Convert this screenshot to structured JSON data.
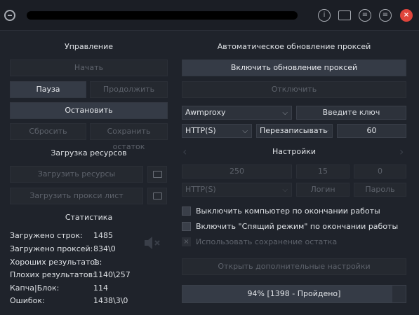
{
  "control": {
    "title": "Управление",
    "start": "Начать",
    "pause": "Пауза",
    "resume": "Продолжить",
    "stop": "Остановить",
    "reset": "Сбросить",
    "save_remainder": "Сохранить остаток"
  },
  "resources": {
    "title": "Загрузка ресурсов",
    "load_resources": "Загрузить ресурсы",
    "load_proxy_list": "Загрузить прокси лист"
  },
  "stats": {
    "title": "Статистика",
    "rows": [
      {
        "label": "Загружено строк:",
        "value": "1485"
      },
      {
        "label": "Загружено проксей:",
        "value": "834\\0"
      },
      {
        "label": "Хороших результатов:",
        "value": "1"
      },
      {
        "label": "Плохих результатов:",
        "value": "1140\\257"
      },
      {
        "label": "Капча|Блок:",
        "value": "114"
      },
      {
        "label": "Ошибок:",
        "value": "1438\\3\\0"
      }
    ]
  },
  "proxy_update": {
    "title": "Автоматическое обновление проксей",
    "enable": "Включить обновление проксей",
    "disable": "Отключить",
    "provider": "Awmproxy",
    "key_placeholder": "Введите ключ",
    "protocol": "HTTP(S)",
    "mode": "Перезаписывать",
    "interval": "60"
  },
  "settings": {
    "title": "Настройки",
    "threads": "250",
    "timeout": "15",
    "retries": "0",
    "protocol": "HTTP(S)",
    "login_placeholder": "Логин",
    "password_placeholder": "Пароль",
    "checkbox_shutdown": "Выключить компьютер по окончании работы",
    "checkbox_sleep": "Включить \"Спящий режим\" по окончании работы",
    "checkbox_save": "Использовать сохранение остатка",
    "open_more": "Открыть дополнительные настройки"
  },
  "progress": {
    "percent": 94,
    "text": "94% [1398 - Пройдено]"
  },
  "icons": {
    "info": "i",
    "close": "×"
  }
}
